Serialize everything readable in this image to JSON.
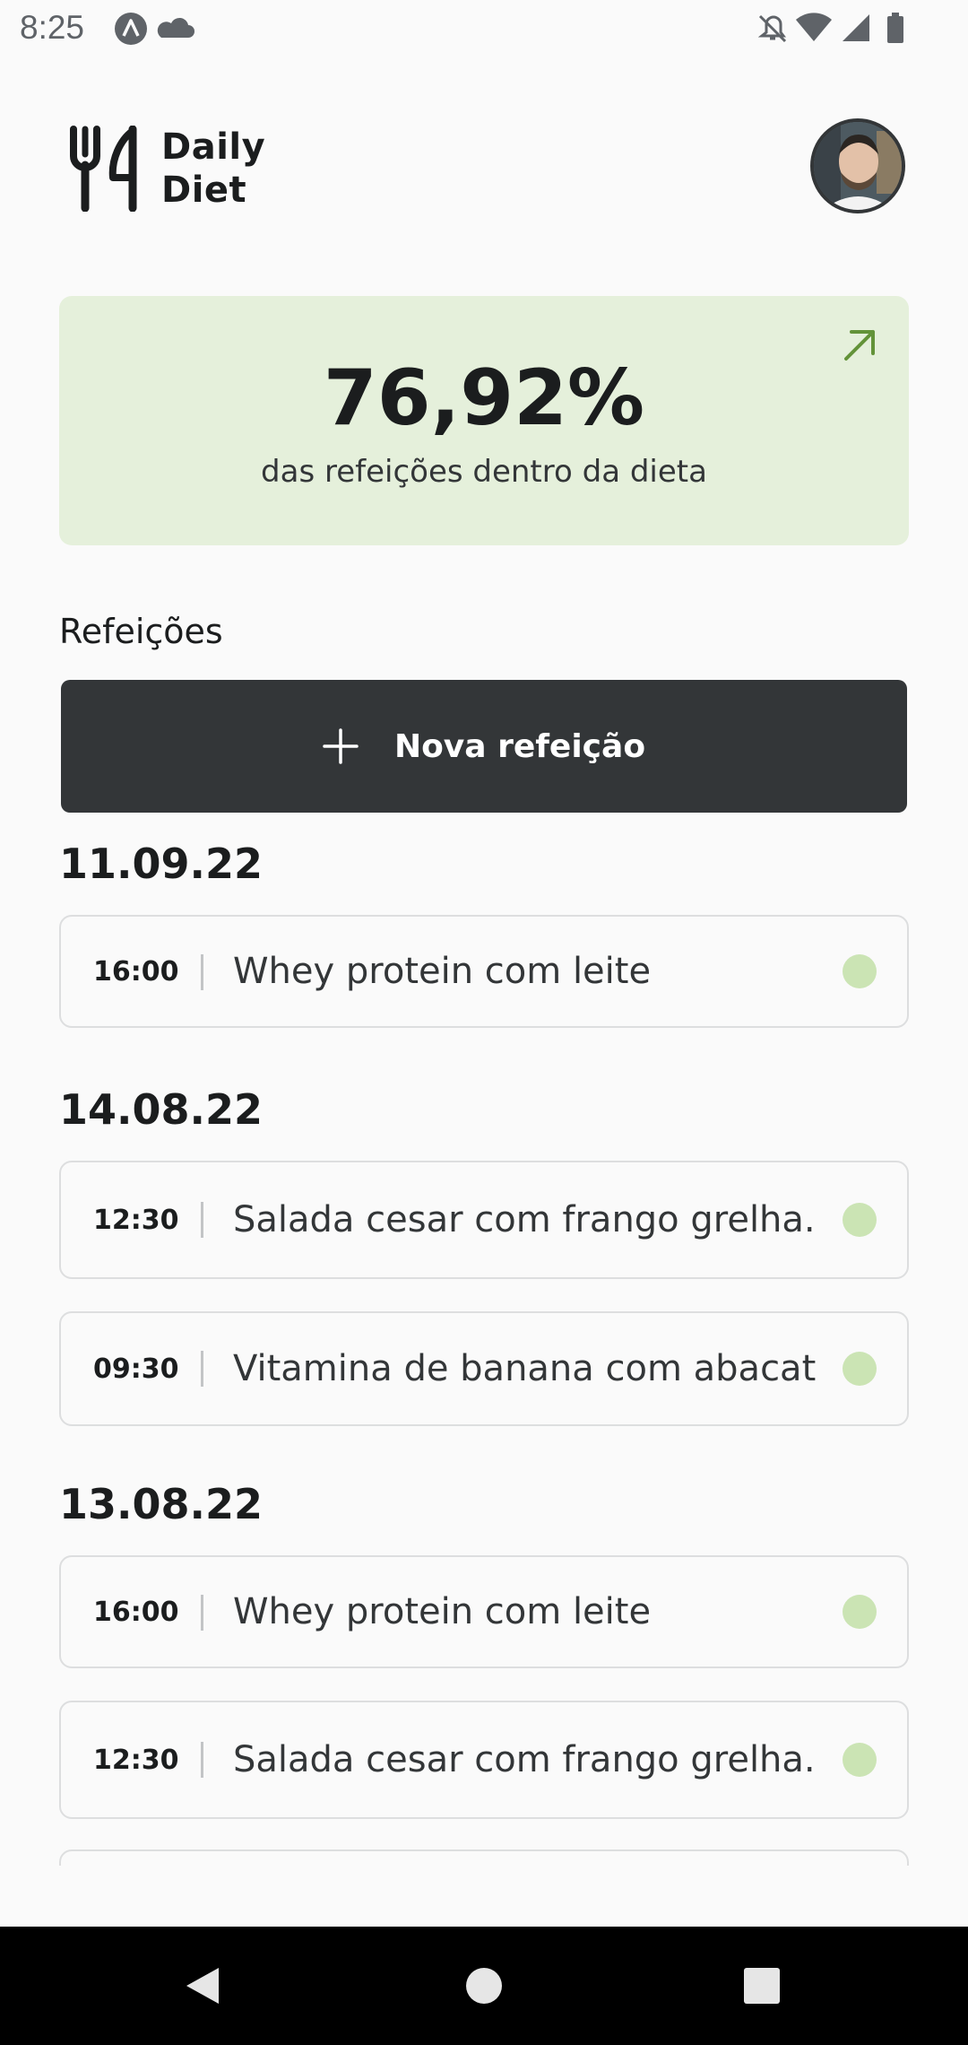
{
  "status_bar": {
    "time": "8:25"
  },
  "header": {
    "app_name": "Daily\nDiet"
  },
  "stats": {
    "percent": "76,92%",
    "subtitle": "das refeições dentro da dieta",
    "color": "#e5f0db",
    "accent": "#639339"
  },
  "meals_section": {
    "title": "Refeições",
    "new_meal_label": "Nova refeição"
  },
  "meal_groups": [
    {
      "date": "11.09.22",
      "meals": [
        {
          "time": "16:00",
          "name": "Whey protein com leite",
          "in_diet": true
        }
      ]
    },
    {
      "date": "14.08.22",
      "meals": [
        {
          "time": "12:30",
          "name": "Salada cesar com frango grelha...",
          "in_diet": true
        },
        {
          "time": "09:30",
          "name": "Vitamina de banana com abacate",
          "in_diet": true
        }
      ]
    },
    {
      "date": "13.08.22",
      "meals": [
        {
          "time": "16:00",
          "name": "Whey protein com leite",
          "in_diet": true
        },
        {
          "time": "12:30",
          "name": "Salada cesar com frango grelha...",
          "in_diet": true
        }
      ]
    }
  ],
  "colors": {
    "in_diet_dot": "#cbe4b4",
    "off_diet_dot": "#f3babd",
    "button_bg": "#333638"
  }
}
